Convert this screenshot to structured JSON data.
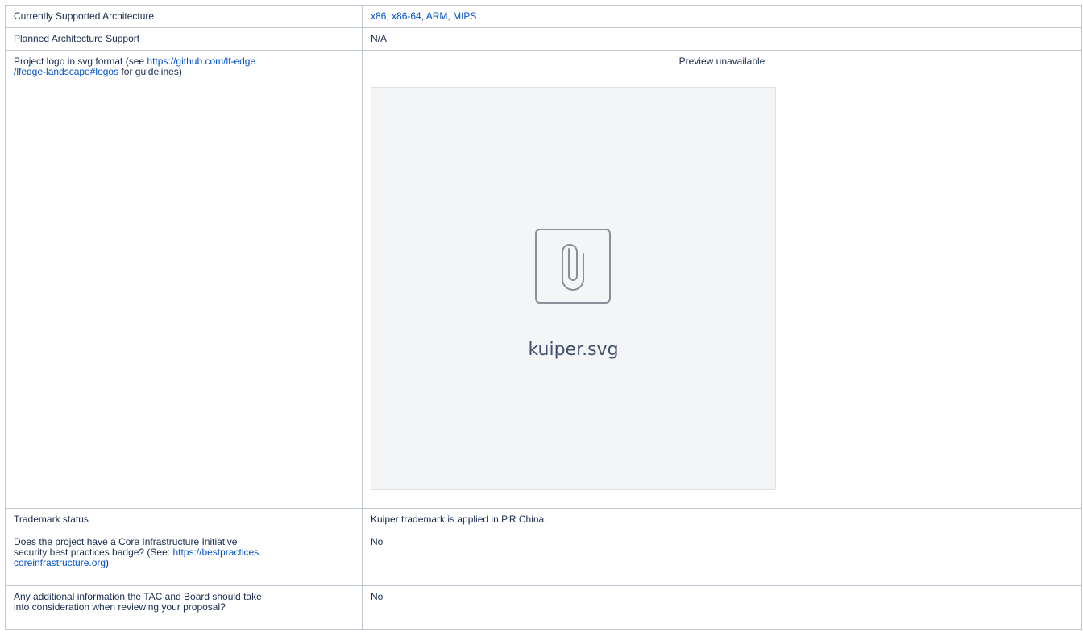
{
  "rows": {
    "arch": {
      "label": "Currently Supported Architecture",
      "values": [
        "x86",
        "x86-64",
        "ARM",
        "MIPS"
      ],
      "separator": ", "
    },
    "planned": {
      "label": "Planned Architecture Support",
      "value": "N/A"
    },
    "logo": {
      "label_prefix": "Project logo in svg format (see ",
      "link_line1": "https://github.com/lf-edge",
      "link_line2": "/lfedge-landscape#logos",
      "label_suffix": " for guidelines)",
      "preview_title": "Preview unavailable",
      "file_name": "kuiper.svg",
      "icon": "paperclip-icon"
    },
    "trademark": {
      "label": "Trademark status",
      "value": "Kuiper trademark is applied in P.R China."
    },
    "badge": {
      "label_line1": "Does the project have a Core Infrastructure Initiative",
      "label_line2_prefix": "security best practices badge? (See: ",
      "link_line1": "https://bestpractices.",
      "link_line2": "coreinfrastructure.org",
      "label_suffix": ")",
      "value": "No"
    },
    "additional": {
      "label_line1": "Any additional information the TAC and Board should take",
      "label_line2": "into consideration when reviewing your proposal?",
      "value": "No"
    }
  },
  "colors": {
    "link": "#0052cc",
    "text": "#172b4d",
    "border": "#c1c7d0",
    "preview_bg": "#f4f5f7"
  }
}
